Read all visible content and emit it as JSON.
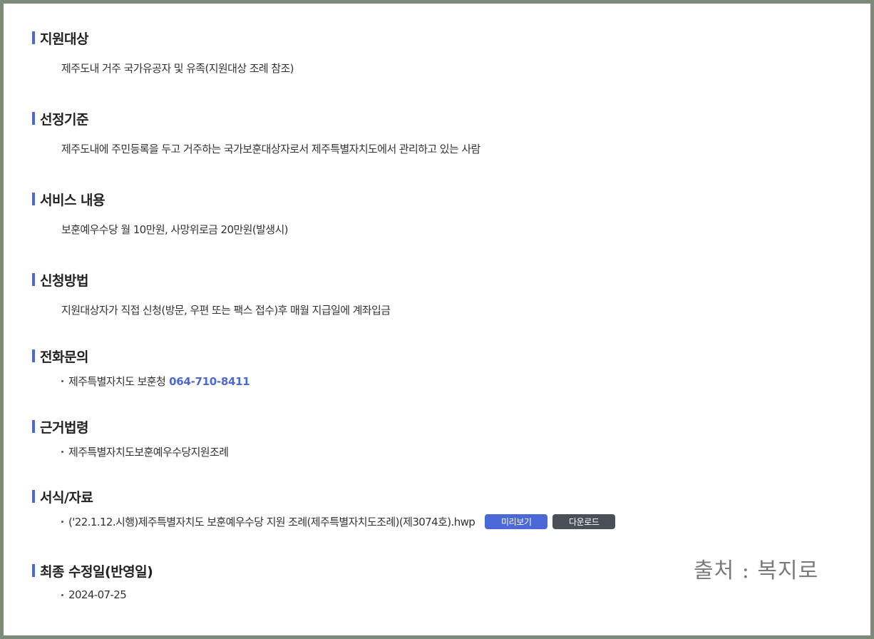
{
  "sections": {
    "target": {
      "title": "지원대상",
      "text": "제주도내 거주 국가유공자 및 유족(지원대상 조례 참조)"
    },
    "criteria": {
      "title": "선정기준",
      "text": "제주도내에 주민등록을 두고 거주하는 국가보훈대상자로서 제주특별자치도에서 관리하고 있는 사람"
    },
    "service": {
      "title": "서비스 내용",
      "text": "보훈예우수당 월 10만원, 사망위로금 20만원(발생시)"
    },
    "apply": {
      "title": "신청방법",
      "text": "지원대상자가 직접 신청(방문, 우편 또는 팩스 접수)후 매월 지급일에 계좌입금"
    },
    "contact": {
      "title": "전화문의",
      "org": "제주특별자치도 보훈청",
      "phone": "064-710-8411"
    },
    "law": {
      "title": "근거법령",
      "item": "제주특별자치도보훈예우수당지원조례"
    },
    "forms": {
      "title": "서식/자료",
      "file": "('22.1.12.시행)제주특별자치도 보훈예우수당 지원 조례(제주특별자치도조례)(제3074호).hwp",
      "preview_label": "미리보기",
      "download_label": "다운로드"
    },
    "updated": {
      "title": "최종 수정일(반영일)",
      "date": "2024-07-25"
    }
  },
  "watermark": "출처 : 복지로",
  "colors": {
    "accent": "#4a68d6",
    "download_button": "#4a4f58",
    "frame_border": "#7d8a7a"
  }
}
